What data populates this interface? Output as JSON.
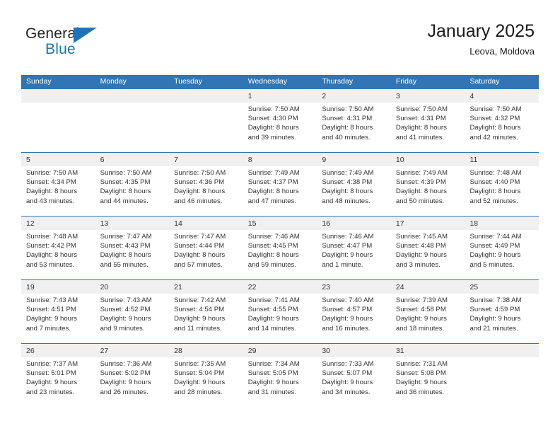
{
  "brand": {
    "name_top": "General",
    "name_bottom": "Blue",
    "flag_color": "#1b75bb"
  },
  "header": {
    "title": "January 2025",
    "subtitle": "Leova, Moldova"
  },
  "theme": {
    "header_blue": "#3175b4",
    "band_gray": "#f0f0f0",
    "text": "#333333"
  },
  "calendar": {
    "weekday_headers": [
      "Sunday",
      "Monday",
      "Tuesday",
      "Wednesday",
      "Thursday",
      "Friday",
      "Saturday"
    ],
    "weeks": [
      [
        {
          "day": "",
          "sunrise": "",
          "sunset": "",
          "daylight1": "",
          "daylight2": ""
        },
        {
          "day": "",
          "sunrise": "",
          "sunset": "",
          "daylight1": "",
          "daylight2": ""
        },
        {
          "day": "",
          "sunrise": "",
          "sunset": "",
          "daylight1": "",
          "daylight2": ""
        },
        {
          "day": "1",
          "sunrise": "Sunrise: 7:50 AM",
          "sunset": "Sunset: 4:30 PM",
          "daylight1": "Daylight: 8 hours",
          "daylight2": "and 39 minutes."
        },
        {
          "day": "2",
          "sunrise": "Sunrise: 7:50 AM",
          "sunset": "Sunset: 4:31 PM",
          "daylight1": "Daylight: 8 hours",
          "daylight2": "and 40 minutes."
        },
        {
          "day": "3",
          "sunrise": "Sunrise: 7:50 AM",
          "sunset": "Sunset: 4:31 PM",
          "daylight1": "Daylight: 8 hours",
          "daylight2": "and 41 minutes."
        },
        {
          "day": "4",
          "sunrise": "Sunrise: 7:50 AM",
          "sunset": "Sunset: 4:32 PM",
          "daylight1": "Daylight: 8 hours",
          "daylight2": "and 42 minutes."
        }
      ],
      [
        {
          "day": "5",
          "sunrise": "Sunrise: 7:50 AM",
          "sunset": "Sunset: 4:34 PM",
          "daylight1": "Daylight: 8 hours",
          "daylight2": "and 43 minutes."
        },
        {
          "day": "6",
          "sunrise": "Sunrise: 7:50 AM",
          "sunset": "Sunset: 4:35 PM",
          "daylight1": "Daylight: 8 hours",
          "daylight2": "and 44 minutes."
        },
        {
          "day": "7",
          "sunrise": "Sunrise: 7:50 AM",
          "sunset": "Sunset: 4:36 PM",
          "daylight1": "Daylight: 8 hours",
          "daylight2": "and 46 minutes."
        },
        {
          "day": "8",
          "sunrise": "Sunrise: 7:49 AM",
          "sunset": "Sunset: 4:37 PM",
          "daylight1": "Daylight: 8 hours",
          "daylight2": "and 47 minutes."
        },
        {
          "day": "9",
          "sunrise": "Sunrise: 7:49 AM",
          "sunset": "Sunset: 4:38 PM",
          "daylight1": "Daylight: 8 hours",
          "daylight2": "and 48 minutes."
        },
        {
          "day": "10",
          "sunrise": "Sunrise: 7:49 AM",
          "sunset": "Sunset: 4:39 PM",
          "daylight1": "Daylight: 8 hours",
          "daylight2": "and 50 minutes."
        },
        {
          "day": "11",
          "sunrise": "Sunrise: 7:48 AM",
          "sunset": "Sunset: 4:40 PM",
          "daylight1": "Daylight: 8 hours",
          "daylight2": "and 52 minutes."
        }
      ],
      [
        {
          "day": "12",
          "sunrise": "Sunrise: 7:48 AM",
          "sunset": "Sunset: 4:42 PM",
          "daylight1": "Daylight: 8 hours",
          "daylight2": "and 53 minutes."
        },
        {
          "day": "13",
          "sunrise": "Sunrise: 7:47 AM",
          "sunset": "Sunset: 4:43 PM",
          "daylight1": "Daylight: 8 hours",
          "daylight2": "and 55 minutes."
        },
        {
          "day": "14",
          "sunrise": "Sunrise: 7:47 AM",
          "sunset": "Sunset: 4:44 PM",
          "daylight1": "Daylight: 8 hours",
          "daylight2": "and 57 minutes."
        },
        {
          "day": "15",
          "sunrise": "Sunrise: 7:46 AM",
          "sunset": "Sunset: 4:45 PM",
          "daylight1": "Daylight: 8 hours",
          "daylight2": "and 59 minutes."
        },
        {
          "day": "16",
          "sunrise": "Sunrise: 7:46 AM",
          "sunset": "Sunset: 4:47 PM",
          "daylight1": "Daylight: 9 hours",
          "daylight2": "and 1 minute."
        },
        {
          "day": "17",
          "sunrise": "Sunrise: 7:45 AM",
          "sunset": "Sunset: 4:48 PM",
          "daylight1": "Daylight: 9 hours",
          "daylight2": "and 3 minutes."
        },
        {
          "day": "18",
          "sunrise": "Sunrise: 7:44 AM",
          "sunset": "Sunset: 4:49 PM",
          "daylight1": "Daylight: 9 hours",
          "daylight2": "and 5 minutes."
        }
      ],
      [
        {
          "day": "19",
          "sunrise": "Sunrise: 7:43 AM",
          "sunset": "Sunset: 4:51 PM",
          "daylight1": "Daylight: 9 hours",
          "daylight2": "and 7 minutes."
        },
        {
          "day": "20",
          "sunrise": "Sunrise: 7:43 AM",
          "sunset": "Sunset: 4:52 PM",
          "daylight1": "Daylight: 9 hours",
          "daylight2": "and 9 minutes."
        },
        {
          "day": "21",
          "sunrise": "Sunrise: 7:42 AM",
          "sunset": "Sunset: 4:54 PM",
          "daylight1": "Daylight: 9 hours",
          "daylight2": "and 11 minutes."
        },
        {
          "day": "22",
          "sunrise": "Sunrise: 7:41 AM",
          "sunset": "Sunset: 4:55 PM",
          "daylight1": "Daylight: 9 hours",
          "daylight2": "and 14 minutes."
        },
        {
          "day": "23",
          "sunrise": "Sunrise: 7:40 AM",
          "sunset": "Sunset: 4:57 PM",
          "daylight1": "Daylight: 9 hours",
          "daylight2": "and 16 minutes."
        },
        {
          "day": "24",
          "sunrise": "Sunrise: 7:39 AM",
          "sunset": "Sunset: 4:58 PM",
          "daylight1": "Daylight: 9 hours",
          "daylight2": "and 18 minutes."
        },
        {
          "day": "25",
          "sunrise": "Sunrise: 7:38 AM",
          "sunset": "Sunset: 4:59 PM",
          "daylight1": "Daylight: 9 hours",
          "daylight2": "and 21 minutes."
        }
      ],
      [
        {
          "day": "26",
          "sunrise": "Sunrise: 7:37 AM",
          "sunset": "Sunset: 5:01 PM",
          "daylight1": "Daylight: 9 hours",
          "daylight2": "and 23 minutes."
        },
        {
          "day": "27",
          "sunrise": "Sunrise: 7:36 AM",
          "sunset": "Sunset: 5:02 PM",
          "daylight1": "Daylight: 9 hours",
          "daylight2": "and 26 minutes."
        },
        {
          "day": "28",
          "sunrise": "Sunrise: 7:35 AM",
          "sunset": "Sunset: 5:04 PM",
          "daylight1": "Daylight: 9 hours",
          "daylight2": "and 28 minutes."
        },
        {
          "day": "29",
          "sunrise": "Sunrise: 7:34 AM",
          "sunset": "Sunset: 5:05 PM",
          "daylight1": "Daylight: 9 hours",
          "daylight2": "and 31 minutes."
        },
        {
          "day": "30",
          "sunrise": "Sunrise: 7:33 AM",
          "sunset": "Sunset: 5:07 PM",
          "daylight1": "Daylight: 9 hours",
          "daylight2": "and 34 minutes."
        },
        {
          "day": "31",
          "sunrise": "Sunrise: 7:31 AM",
          "sunset": "Sunset: 5:08 PM",
          "daylight1": "Daylight: 9 hours",
          "daylight2": "and 36 minutes."
        },
        {
          "day": "",
          "sunrise": "",
          "sunset": "",
          "daylight1": "",
          "daylight2": ""
        }
      ]
    ]
  }
}
